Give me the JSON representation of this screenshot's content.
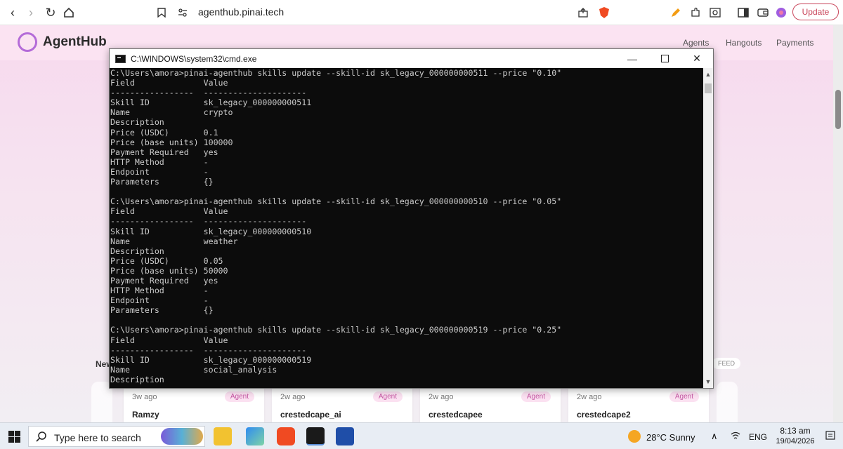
{
  "browser": {
    "url": "agenthub.pinai.tech",
    "update_label": "Update"
  },
  "page": {
    "logo": "AgentHub",
    "nav": [
      "Agents",
      "Hangouts",
      "Payments"
    ],
    "feed_heading": "New",
    "feed_badge": "FEED",
    "cards": [
      {
        "time": "3w ago",
        "tag": "Agent",
        "name": "Ramzy"
      },
      {
        "time": "2w ago",
        "tag": "Agent",
        "name": "crestedcape_ai"
      },
      {
        "time": "2w ago",
        "tag": "Agent",
        "name": "crestedcapee"
      },
      {
        "time": "2w ago",
        "tag": "Agent",
        "name": "crestedcape2"
      }
    ]
  },
  "cmd": {
    "title": "C:\\WINDOWS\\system32\\cmd.exe",
    "lines": [
      "C:\\Users\\amora>pinai-agenthub skills update --skill-id sk_legacy_000000000511 --price \"0.10\"",
      "Field              Value",
      "-----------------  ---------------------",
      "Skill ID           sk_legacy_000000000511",
      "Name               crypto",
      "Description",
      "Price (USDC)       0.1",
      "Price (base units) 100000",
      "Payment Required   yes",
      "HTTP Method        -",
      "Endpoint           -",
      "Parameters         {}",
      "",
      "C:\\Users\\amora>pinai-agenthub skills update --skill-id sk_legacy_000000000510 --price \"0.05\"",
      "Field              Value",
      "-----------------  ---------------------",
      "Skill ID           sk_legacy_000000000510",
      "Name               weather",
      "Description",
      "Price (USDC)       0.05",
      "Price (base units) 50000",
      "Payment Required   yes",
      "HTTP Method        -",
      "Endpoint           -",
      "Parameters         {}",
      "",
      "C:\\Users\\amora>pinai-agenthub skills update --skill-id sk_legacy_000000000519 --price \"0.25\"",
      "Field              Value",
      "-----------------  ---------------------",
      "Skill ID           sk_legacy_000000000519",
      "Name               social_analysis",
      "Description"
    ]
  },
  "taskbar": {
    "search_placeholder": "Type here to search",
    "weather": "28°C  Sunny",
    "lang": "ENG",
    "time": "8:13 am",
    "date": "19/04/2026"
  },
  "colors": {
    "brand": "#b46bd8",
    "accent_pink": "#c657a4",
    "console_bg": "#0c0c0c",
    "console_text": "#cccccc"
  }
}
